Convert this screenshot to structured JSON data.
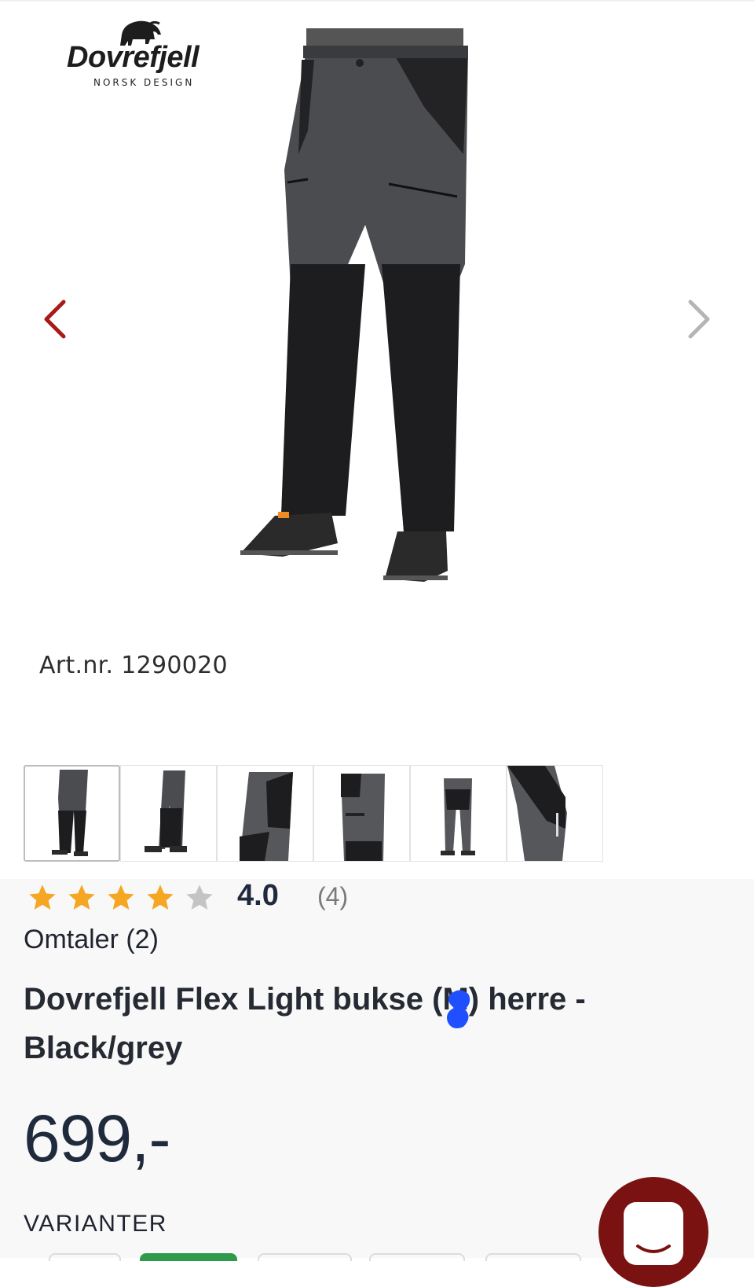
{
  "brand": {
    "name": "Dovrefjell",
    "tagline": "NORSK DESIGN",
    "logo_icon": "muskox-icon"
  },
  "gallery": {
    "prev_icon": "chevron-left-icon",
    "next_icon": "chevron-right-icon",
    "prev_color": "#a81a1a",
    "next_color": "#b5b5b5",
    "thumbnails": [
      "front",
      "side",
      "detail-side",
      "pocket-side",
      "back",
      "leg-detail"
    ],
    "active_thumbnail": 0
  },
  "product": {
    "art_label": "Art.nr.",
    "art_number": "1290020",
    "rating": {
      "stars_filled": 4,
      "stars_total": 5,
      "value": "4.0",
      "count": "(4)",
      "star_color": "#f5a623",
      "empty_star_color": "#c4c4c4"
    },
    "reviews_link": "Omtaler (2)",
    "title": "Dovrefjell Flex Light bukse (M) herre - Black/grey",
    "price": "699,-",
    "variants_label": "VARIANTER"
  },
  "chat": {
    "icon": "chat-icon",
    "color": "#7a1212"
  }
}
